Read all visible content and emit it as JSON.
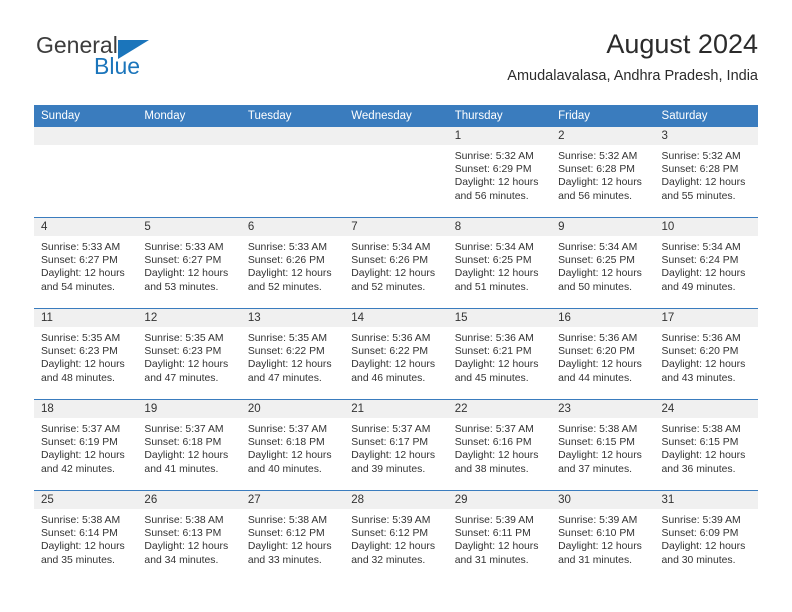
{
  "brand": {
    "word1": "General",
    "word2": "Blue",
    "triangle_color": "#1b75bb",
    "icon": "triangle-logo-icon"
  },
  "header": {
    "title": "August 2024",
    "subtitle": "Amudalavalasa, Andhra Pradesh, India"
  },
  "theme": {
    "header_bg": "#3a7cbe",
    "header_text": "#ffffff",
    "daynum_bg": "#f0f0f0",
    "body_text": "#333333",
    "row_divider": "#3a7cbe"
  },
  "calendar": {
    "weekday_headers": [
      "Sunday",
      "Monday",
      "Tuesday",
      "Wednesday",
      "Thursday",
      "Friday",
      "Saturday"
    ],
    "labels": {
      "sunrise": "Sunrise:",
      "sunset": "Sunset:",
      "daylight": "Daylight:"
    },
    "weeks": [
      [
        {
          "day": "",
          "blank": true,
          "line1": "",
          "line2": "",
          "line3": "",
          "line4": ""
        },
        {
          "day": "",
          "blank": true,
          "line1": "",
          "line2": "",
          "line3": "",
          "line4": ""
        },
        {
          "day": "",
          "blank": true,
          "line1": "",
          "line2": "",
          "line3": "",
          "line4": ""
        },
        {
          "day": "",
          "blank": true,
          "line1": "",
          "line2": "",
          "line3": "",
          "line4": ""
        },
        {
          "day": "1",
          "blank": false,
          "line1": "Sunrise: 5:32 AM",
          "line2": "Sunset: 6:29 PM",
          "line3": "Daylight: 12 hours",
          "line4": "and 56 minutes."
        },
        {
          "day": "2",
          "blank": false,
          "line1": "Sunrise: 5:32 AM",
          "line2": "Sunset: 6:28 PM",
          "line3": "Daylight: 12 hours",
          "line4": "and 56 minutes."
        },
        {
          "day": "3",
          "blank": false,
          "line1": "Sunrise: 5:32 AM",
          "line2": "Sunset: 6:28 PM",
          "line3": "Daylight: 12 hours",
          "line4": "and 55 minutes."
        }
      ],
      [
        {
          "day": "4",
          "blank": false,
          "line1": "Sunrise: 5:33 AM",
          "line2": "Sunset: 6:27 PM",
          "line3": "Daylight: 12 hours",
          "line4": "and 54 minutes."
        },
        {
          "day": "5",
          "blank": false,
          "line1": "Sunrise: 5:33 AM",
          "line2": "Sunset: 6:27 PM",
          "line3": "Daylight: 12 hours",
          "line4": "and 53 minutes."
        },
        {
          "day": "6",
          "blank": false,
          "line1": "Sunrise: 5:33 AM",
          "line2": "Sunset: 6:26 PM",
          "line3": "Daylight: 12 hours",
          "line4": "and 52 minutes."
        },
        {
          "day": "7",
          "blank": false,
          "line1": "Sunrise: 5:34 AM",
          "line2": "Sunset: 6:26 PM",
          "line3": "Daylight: 12 hours",
          "line4": "and 52 minutes."
        },
        {
          "day": "8",
          "blank": false,
          "line1": "Sunrise: 5:34 AM",
          "line2": "Sunset: 6:25 PM",
          "line3": "Daylight: 12 hours",
          "line4": "and 51 minutes."
        },
        {
          "day": "9",
          "blank": false,
          "line1": "Sunrise: 5:34 AM",
          "line2": "Sunset: 6:25 PM",
          "line3": "Daylight: 12 hours",
          "line4": "and 50 minutes."
        },
        {
          "day": "10",
          "blank": false,
          "line1": "Sunrise: 5:34 AM",
          "line2": "Sunset: 6:24 PM",
          "line3": "Daylight: 12 hours",
          "line4": "and 49 minutes."
        }
      ],
      [
        {
          "day": "11",
          "blank": false,
          "line1": "Sunrise: 5:35 AM",
          "line2": "Sunset: 6:23 PM",
          "line3": "Daylight: 12 hours",
          "line4": "and 48 minutes."
        },
        {
          "day": "12",
          "blank": false,
          "line1": "Sunrise: 5:35 AM",
          "line2": "Sunset: 6:23 PM",
          "line3": "Daylight: 12 hours",
          "line4": "and 47 minutes."
        },
        {
          "day": "13",
          "blank": false,
          "line1": "Sunrise: 5:35 AM",
          "line2": "Sunset: 6:22 PM",
          "line3": "Daylight: 12 hours",
          "line4": "and 47 minutes."
        },
        {
          "day": "14",
          "blank": false,
          "line1": "Sunrise: 5:36 AM",
          "line2": "Sunset: 6:22 PM",
          "line3": "Daylight: 12 hours",
          "line4": "and 46 minutes."
        },
        {
          "day": "15",
          "blank": false,
          "line1": "Sunrise: 5:36 AM",
          "line2": "Sunset: 6:21 PM",
          "line3": "Daylight: 12 hours",
          "line4": "and 45 minutes."
        },
        {
          "day": "16",
          "blank": false,
          "line1": "Sunrise: 5:36 AM",
          "line2": "Sunset: 6:20 PM",
          "line3": "Daylight: 12 hours",
          "line4": "and 44 minutes."
        },
        {
          "day": "17",
          "blank": false,
          "line1": "Sunrise: 5:36 AM",
          "line2": "Sunset: 6:20 PM",
          "line3": "Daylight: 12 hours",
          "line4": "and 43 minutes."
        }
      ],
      [
        {
          "day": "18",
          "blank": false,
          "line1": "Sunrise: 5:37 AM",
          "line2": "Sunset: 6:19 PM",
          "line3": "Daylight: 12 hours",
          "line4": "and 42 minutes."
        },
        {
          "day": "19",
          "blank": false,
          "line1": "Sunrise: 5:37 AM",
          "line2": "Sunset: 6:18 PM",
          "line3": "Daylight: 12 hours",
          "line4": "and 41 minutes."
        },
        {
          "day": "20",
          "blank": false,
          "line1": "Sunrise: 5:37 AM",
          "line2": "Sunset: 6:18 PM",
          "line3": "Daylight: 12 hours",
          "line4": "and 40 minutes."
        },
        {
          "day": "21",
          "blank": false,
          "line1": "Sunrise: 5:37 AM",
          "line2": "Sunset: 6:17 PM",
          "line3": "Daylight: 12 hours",
          "line4": "and 39 minutes."
        },
        {
          "day": "22",
          "blank": false,
          "line1": "Sunrise: 5:37 AM",
          "line2": "Sunset: 6:16 PM",
          "line3": "Daylight: 12 hours",
          "line4": "and 38 minutes."
        },
        {
          "day": "23",
          "blank": false,
          "line1": "Sunrise: 5:38 AM",
          "line2": "Sunset: 6:15 PM",
          "line3": "Daylight: 12 hours",
          "line4": "and 37 minutes."
        },
        {
          "day": "24",
          "blank": false,
          "line1": "Sunrise: 5:38 AM",
          "line2": "Sunset: 6:15 PM",
          "line3": "Daylight: 12 hours",
          "line4": "and 36 minutes."
        }
      ],
      [
        {
          "day": "25",
          "blank": false,
          "line1": "Sunrise: 5:38 AM",
          "line2": "Sunset: 6:14 PM",
          "line3": "Daylight: 12 hours",
          "line4": "and 35 minutes."
        },
        {
          "day": "26",
          "blank": false,
          "line1": "Sunrise: 5:38 AM",
          "line2": "Sunset: 6:13 PM",
          "line3": "Daylight: 12 hours",
          "line4": "and 34 minutes."
        },
        {
          "day": "27",
          "blank": false,
          "line1": "Sunrise: 5:38 AM",
          "line2": "Sunset: 6:12 PM",
          "line3": "Daylight: 12 hours",
          "line4": "and 33 minutes."
        },
        {
          "day": "28",
          "blank": false,
          "line1": "Sunrise: 5:39 AM",
          "line2": "Sunset: 6:12 PM",
          "line3": "Daylight: 12 hours",
          "line4": "and 32 minutes."
        },
        {
          "day": "29",
          "blank": false,
          "line1": "Sunrise: 5:39 AM",
          "line2": "Sunset: 6:11 PM",
          "line3": "Daylight: 12 hours",
          "line4": "and 31 minutes."
        },
        {
          "day": "30",
          "blank": false,
          "line1": "Sunrise: 5:39 AM",
          "line2": "Sunset: 6:10 PM",
          "line3": "Daylight: 12 hours",
          "line4": "and 31 minutes."
        },
        {
          "day": "31",
          "blank": false,
          "line1": "Sunrise: 5:39 AM",
          "line2": "Sunset: 6:09 PM",
          "line3": "Daylight: 12 hours",
          "line4": "and 30 minutes."
        }
      ]
    ]
  }
}
